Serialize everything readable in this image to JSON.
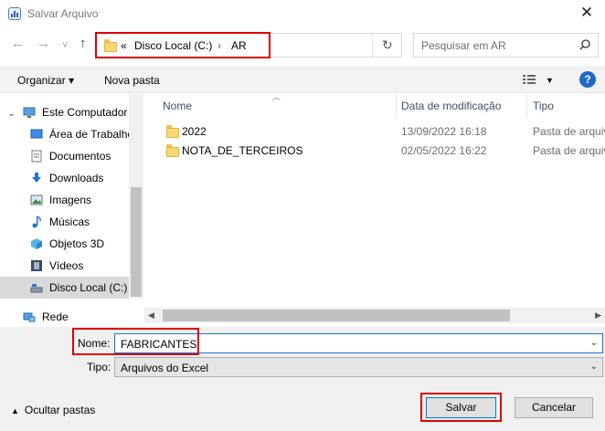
{
  "window": {
    "title": "Salvar Arquivo",
    "close": "✕"
  },
  "nav": {
    "back": "←",
    "forward": "→",
    "recent": "˅",
    "up": "↑"
  },
  "address": {
    "overflow": "«",
    "crumbs": [
      "Disco Local (C:)",
      "AR"
    ],
    "separator": "›",
    "refresh": "↻"
  },
  "search": {
    "placeholder": "Pesquisar em AR"
  },
  "toolbar": {
    "organize": "Organizar ▾",
    "new_folder": "Nova pasta",
    "help": "?"
  },
  "sidebar": {
    "items": [
      {
        "label": "Este Computador",
        "icon": "computer-icon"
      },
      {
        "label": "Área de Trabalho",
        "icon": "desktop-icon"
      },
      {
        "label": "Documentos",
        "icon": "documents-icon"
      },
      {
        "label": "Downloads",
        "icon": "downloads-icon"
      },
      {
        "label": "Imagens",
        "icon": "pictures-icon"
      },
      {
        "label": "Músicas",
        "icon": "music-icon"
      },
      {
        "label": "Objetos 3D",
        "icon": "3d-objects-icon"
      },
      {
        "label": "Vídeos",
        "icon": "videos-icon"
      },
      {
        "label": "Disco Local (C:)",
        "icon": "drive-icon",
        "selected": true
      },
      {
        "label": "Rede",
        "icon": "network-icon"
      }
    ]
  },
  "files": {
    "columns": [
      "Nome",
      "Data de modificação",
      "Tipo"
    ],
    "rows": [
      {
        "name": "2022",
        "date": "13/09/2022 16:18",
        "type": "Pasta de arquivos"
      },
      {
        "name": "NOTA_DE_TERCEIROS",
        "date": "02/05/2022 16:22",
        "type": "Pasta de arquivos"
      }
    ]
  },
  "form": {
    "name_label": "Nome:",
    "name_value": "FABRICANTES",
    "type_label": "Tipo:",
    "type_value": "Arquivos do Excel"
  },
  "footer": {
    "hide_folders": "Ocultar pastas",
    "save": "Salvar",
    "cancel": "Cancelar"
  },
  "colors": {
    "highlight": "#e00000",
    "accent": "#0078d7",
    "folder": "#f8d775"
  }
}
